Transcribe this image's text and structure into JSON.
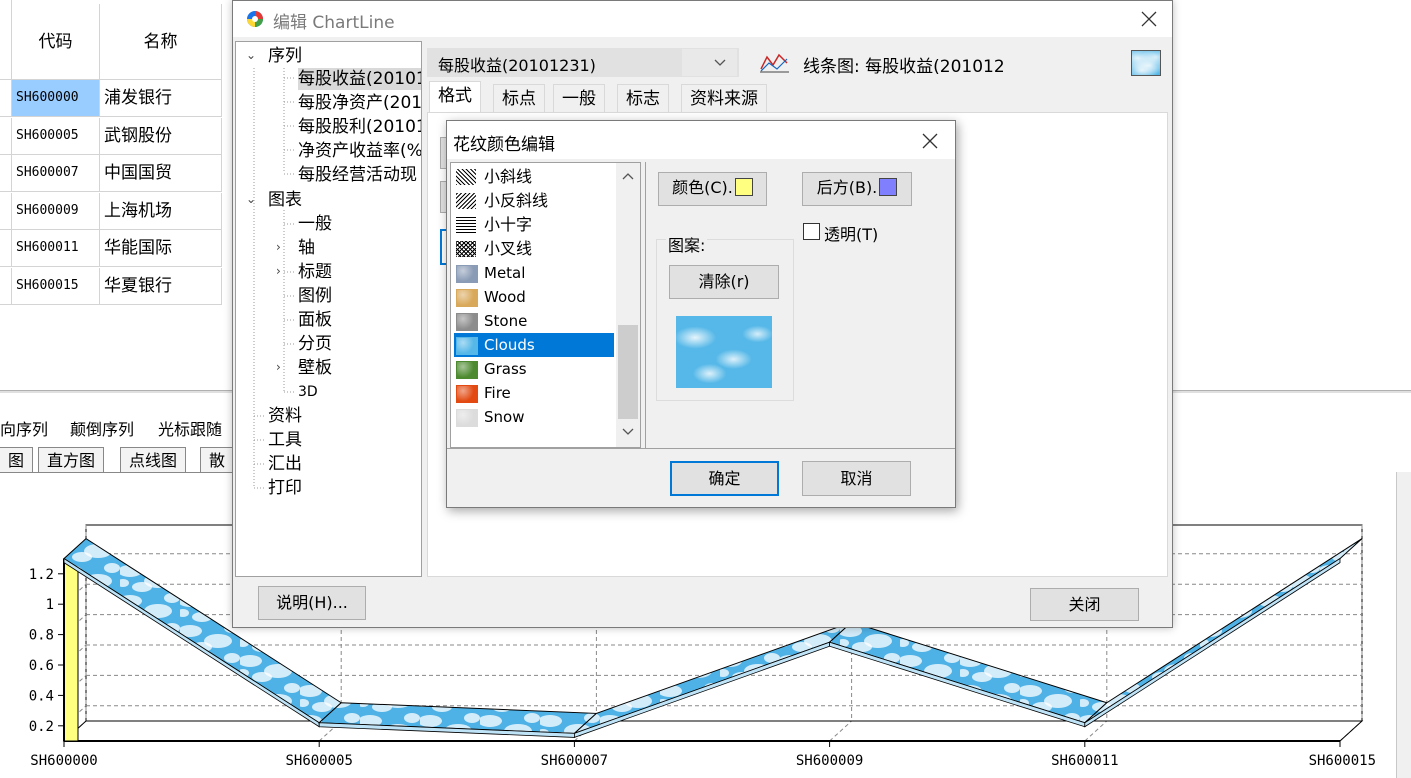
{
  "grid": {
    "columns": [
      "代码",
      "名称"
    ],
    "rows": [
      {
        "code": "SH600000",
        "name": "浦发银行"
      },
      {
        "code": "SH600005",
        "name": "武钢股份"
      },
      {
        "code": "SH600007",
        "name": "中国国贸"
      },
      {
        "code": "SH600009",
        "name": "上海机场"
      },
      {
        "code": "SH600011",
        "name": "华能国际"
      },
      {
        "code": "SH600015",
        "name": "华夏银行"
      }
    ]
  },
  "toolbar": {
    "items": [
      "向序列",
      "颠倒序列",
      "光标跟随"
    ]
  },
  "chart_tabs": [
    "图",
    "直方图",
    "点线图",
    "散"
  ],
  "chart_data": {
    "type": "line",
    "categories": [
      "SH600000",
      "SH600005",
      "SH600007",
      "SH600009",
      "SH600011",
      "SH600015"
    ],
    "series": [
      {
        "values": [
          1.3,
          0.22,
          0.15,
          0.75,
          0.22,
          1.3
        ]
      }
    ],
    "y_ticks": [
      "0.2",
      "0.4",
      "0.6",
      "0.8",
      "1",
      "1.2"
    ],
    "ylim": [
      0.1,
      1.35
    ],
    "grid": true,
    "style": "3d",
    "fill_pattern": "Clouds",
    "wall_color": "#ffff80"
  },
  "dialog_editor": {
    "title": "编辑 ChartLine",
    "tree": {
      "series_group": "序列",
      "series_items": [
        "每股收益(20101",
        "每股净资产(201",
        "每股股利(20101",
        "净资产收益率(%",
        "每股经营活动现"
      ],
      "chart_group": "图表",
      "chart_items": [
        "一般",
        "轴",
        "标题",
        "图例",
        "面板",
        "分页",
        "壁板",
        "3D"
      ],
      "other_items": [
        "资料",
        "工具",
        "汇出",
        "打印"
      ]
    },
    "series_select": "每股收益(20101231)",
    "series_desc": "线条图: 每股收益(201012",
    "tabs": [
      "格式",
      "标点",
      "一般",
      "标志",
      "资料来源"
    ],
    "help_button": "说明(H)...",
    "close_button": "关闭"
  },
  "dialog_pattern": {
    "title": "花纹颜色编辑",
    "patterns": [
      {
        "label": "小斜线",
        "type": "hatch"
      },
      {
        "label": "小反斜线",
        "type": "hatch"
      },
      {
        "label": "小十字",
        "type": "hatch"
      },
      {
        "label": "小叉线",
        "type": "hatch"
      },
      {
        "label": "Metal",
        "type": "texture",
        "color": "#8a9bb5"
      },
      {
        "label": "Wood",
        "type": "texture",
        "color": "#d9a95b"
      },
      {
        "label": "Stone",
        "type": "texture",
        "color": "#8c8c8c"
      },
      {
        "label": "Clouds",
        "type": "texture",
        "color": "#56b8e8"
      },
      {
        "label": "Grass",
        "type": "texture",
        "color": "#4d8a2f"
      },
      {
        "label": "Fire",
        "type": "texture",
        "color": "#e24a12"
      },
      {
        "label": "Snow",
        "type": "texture",
        "color": "#dcdcdc"
      }
    ],
    "selected_pattern": "Clouds",
    "color_button": "颜色(C).",
    "color_value": "#ffff80",
    "back_button": "后方(B).",
    "back_value": "#8080ff",
    "transparent_label": "透明(T)",
    "pattern_group": "图案:",
    "clear_button": "清除(r)",
    "ok_button": "确定",
    "cancel_button": "取消"
  }
}
